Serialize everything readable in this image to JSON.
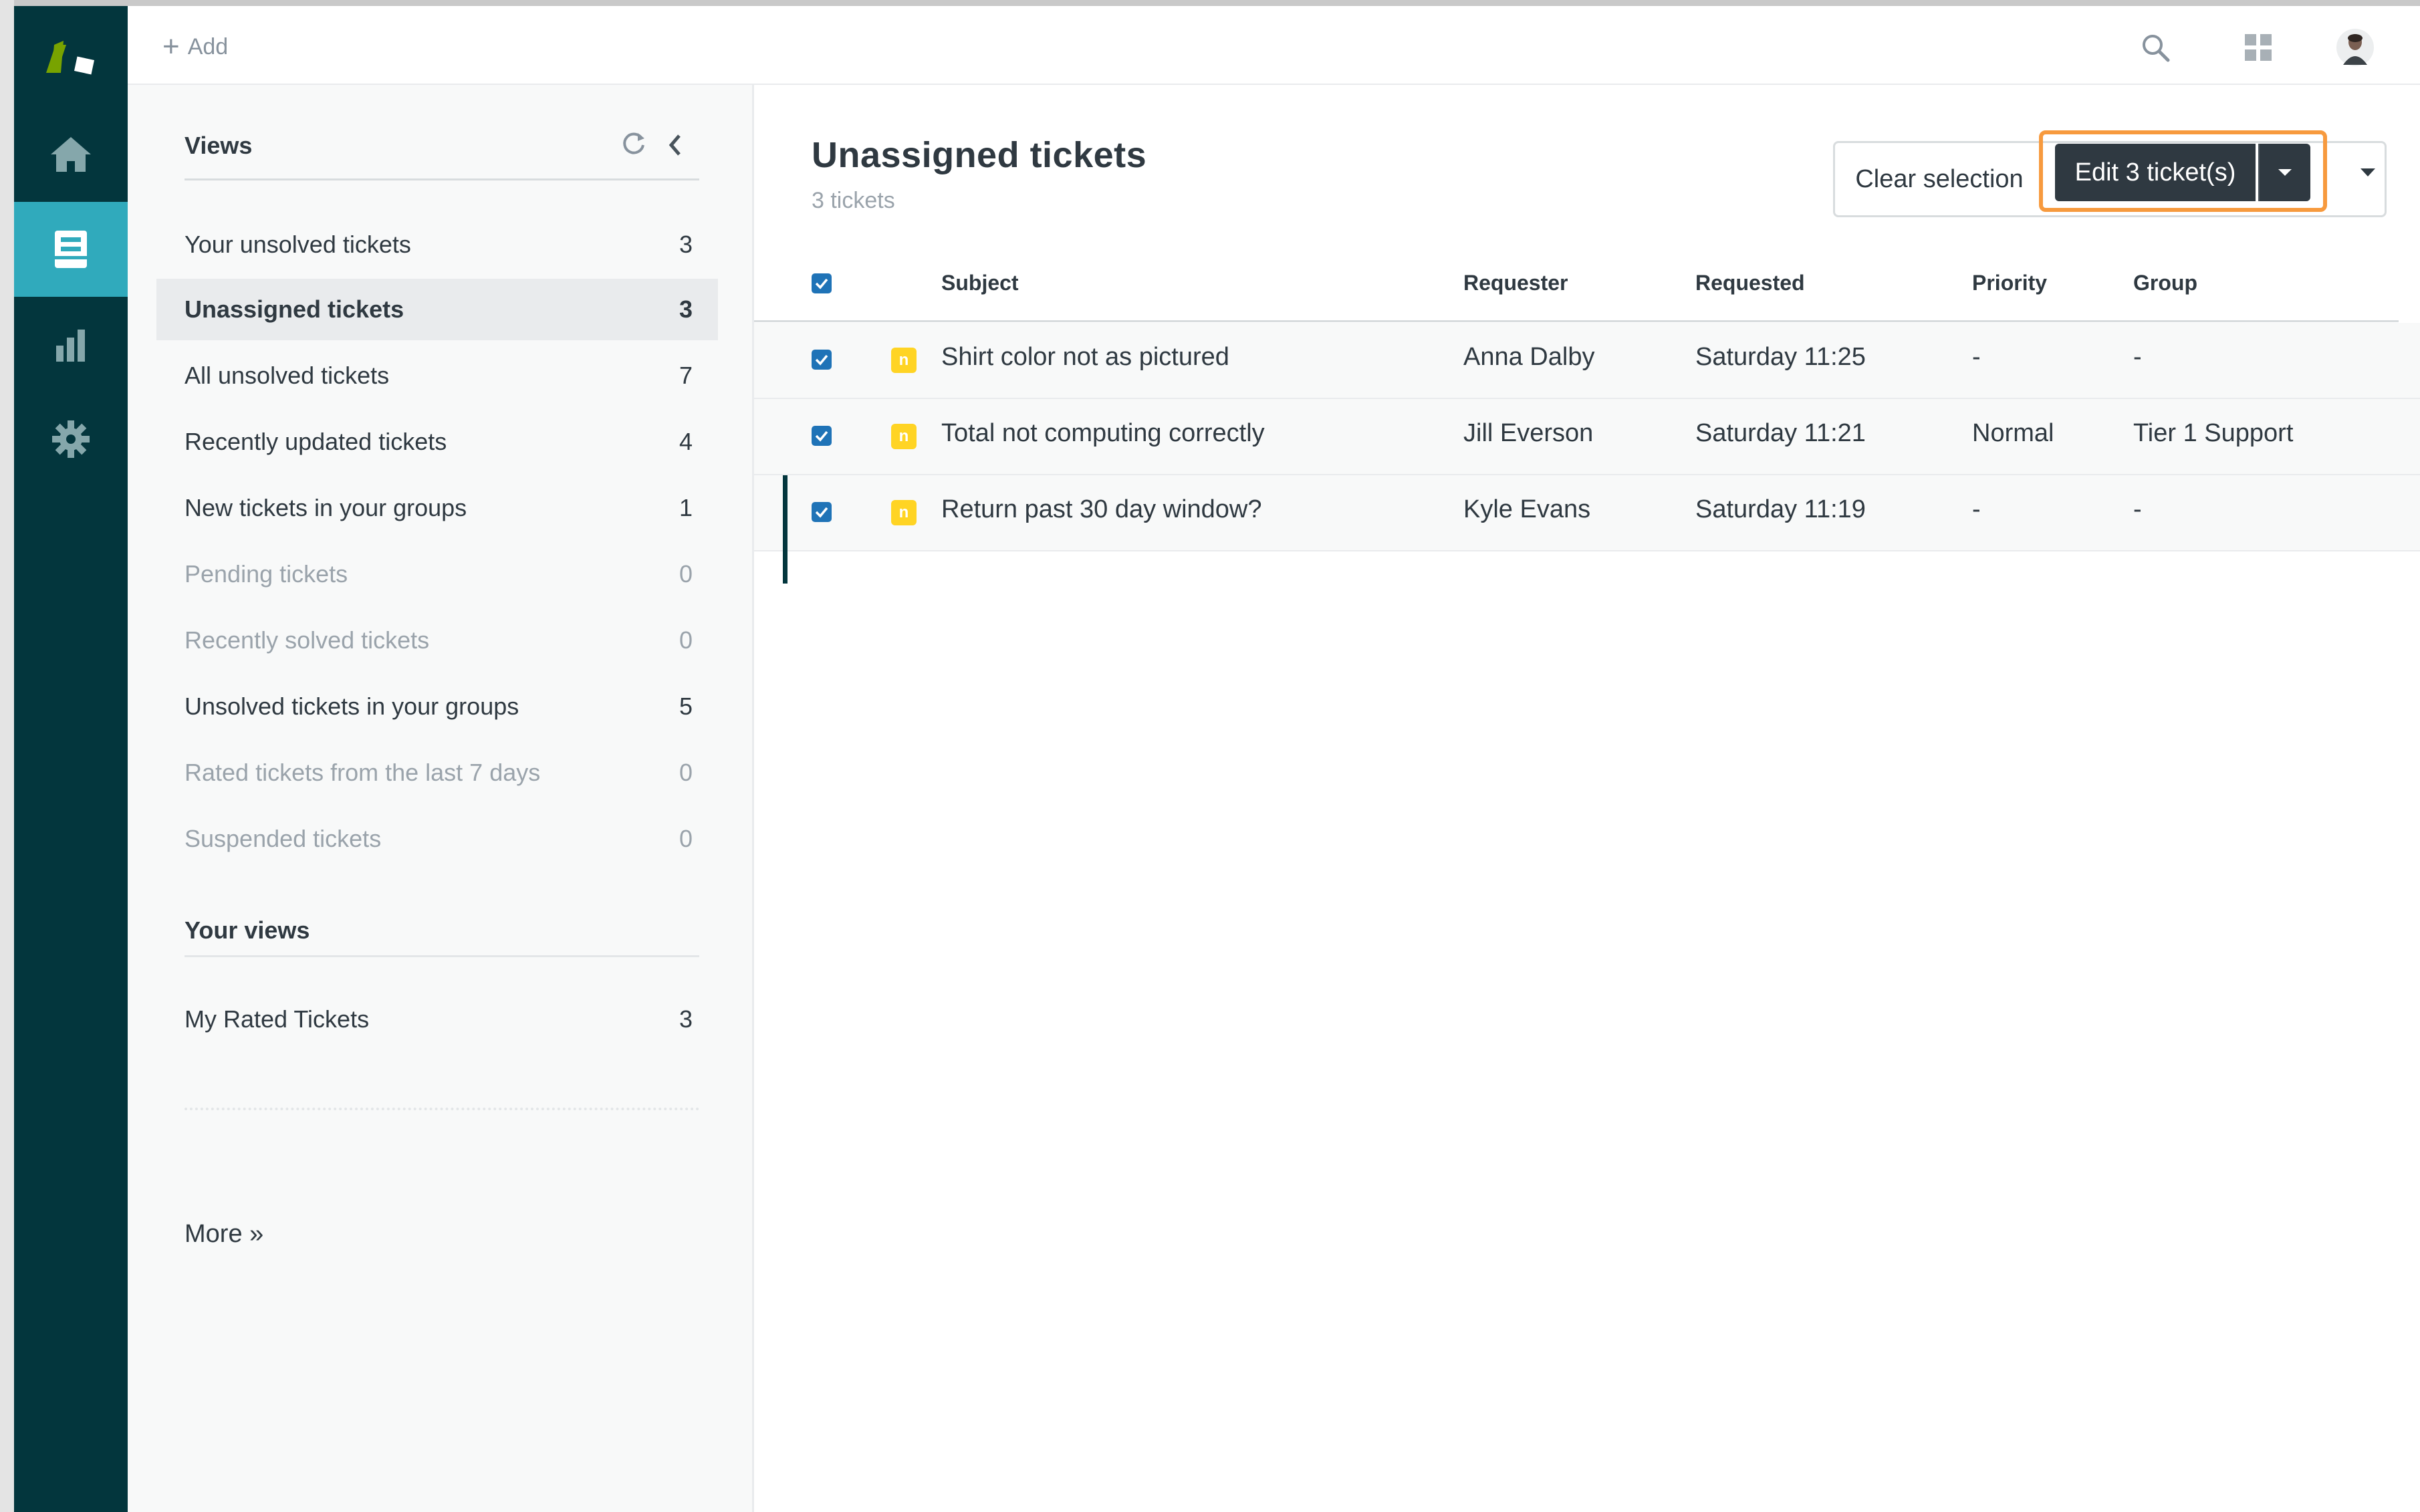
{
  "topbar": {
    "add_label": "Add"
  },
  "views_panel": {
    "title": "Views",
    "items": [
      {
        "label": "Your unsolved tickets",
        "count": "3"
      },
      {
        "label": "Unassigned tickets",
        "count": "3"
      },
      {
        "label": "All unsolved tickets",
        "count": "7"
      },
      {
        "label": "Recently updated tickets",
        "count": "4"
      },
      {
        "label": "New tickets in your groups",
        "count": "1"
      },
      {
        "label": "Pending tickets",
        "count": "0"
      },
      {
        "label": "Recently solved tickets",
        "count": "0"
      },
      {
        "label": "Unsolved tickets in your groups",
        "count": "5"
      },
      {
        "label": "Rated tickets from the last 7 days",
        "count": "0"
      },
      {
        "label": "Suspended tickets",
        "count": "0"
      }
    ],
    "your_views_title": "Your views",
    "your_views": [
      {
        "label": "My Rated Tickets",
        "count": "3"
      }
    ],
    "more_label": "More »"
  },
  "main": {
    "title": "Unassigned tickets",
    "subtitle": "3 tickets",
    "clear_selection_label": "Clear selection",
    "edit_label": "Edit 3 ticket(s)",
    "columns": {
      "subject": "Subject",
      "requester": "Requester",
      "requested": "Requested",
      "priority": "Priority",
      "group": "Group"
    },
    "tickets": [
      {
        "status_letter": "n",
        "subject": "Shirt color not as pictured",
        "requester": "Anna Dalby",
        "requested": "Saturday 11:25",
        "priority": "-",
        "group": "-"
      },
      {
        "status_letter": "n",
        "subject": "Total not computing correctly",
        "requester": "Jill Everson",
        "requested": "Saturday 11:21",
        "priority": "Normal",
        "group": "Tier 1 Support"
      },
      {
        "status_letter": "n",
        "subject": "Return past 30 day window?",
        "requester": "Kyle Evans",
        "requested": "Saturday 11:19",
        "priority": "-",
        "group": "-"
      }
    ]
  },
  "colors": {
    "rail": "#03363d",
    "rail_active": "#30aabc",
    "status_new": "#ffd424",
    "checkbox": "#1f73b7",
    "highlight": "#f79a3e"
  }
}
